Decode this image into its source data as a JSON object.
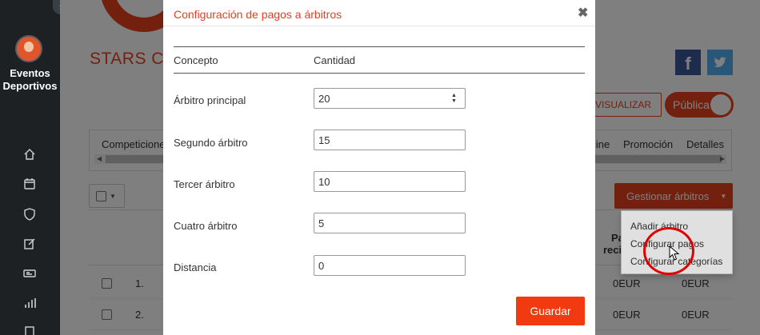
{
  "sidebar": {
    "brand": "Eventos Deportivos",
    "collapse_icon": "chevron-right-icon",
    "items": [
      {
        "icon": "home-icon"
      },
      {
        "icon": "calendar-icon"
      },
      {
        "icon": "shield-icon"
      },
      {
        "icon": "edit-icon"
      },
      {
        "icon": "ticket-icon"
      },
      {
        "icon": "bar-chart-icon"
      },
      {
        "icon": "building-icon"
      }
    ]
  },
  "background": {
    "title": "STARS CU",
    "preview_label": "EVISUALIZAR",
    "public_label": "Pública",
    "tabs": [
      "Competicione",
      "line",
      "Promoción",
      "Detalles"
    ],
    "manage_label": "Gestionar árbitros",
    "dropdown_items": [
      "Añadir árbitro",
      "Configurar pagos",
      "Configurar categorías"
    ],
    "table_header_right": [
      "Pa",
      "reci"
    ],
    "rows": [
      {
        "num": "1.",
        "v1": "0EUR",
        "v2": "0EUR"
      },
      {
        "num": "2.",
        "v1": "0EUR",
        "v2": "0EUR"
      }
    ]
  },
  "modal": {
    "title": "Configuración de pagos a árbitros",
    "close_glyph": "✖",
    "col_concept": "Concepto",
    "col_amount": "Cantidad",
    "fields": [
      {
        "label": "Árbitro principal",
        "value": "20"
      },
      {
        "label": "Segundo árbitro",
        "value": "15"
      },
      {
        "label": "Tercer árbitro",
        "value": "10"
      },
      {
        "label": "Cuatro árbitro",
        "value": "5"
      },
      {
        "label": "Distancia",
        "value": "0"
      }
    ],
    "save_label": "Guardar"
  },
  "colors": {
    "accent": "#e8401c",
    "sidebar": "#1e2124",
    "facebook": "#3b5998",
    "twitter": "#55acee"
  }
}
